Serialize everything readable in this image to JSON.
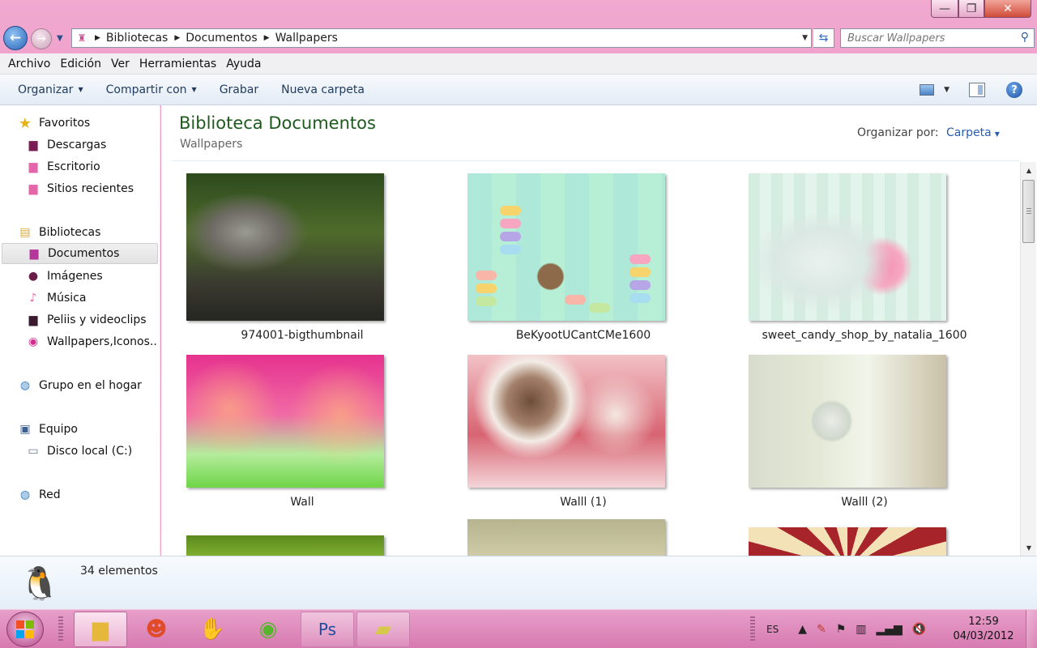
{
  "window": {
    "minimize_glyph": "—",
    "maximize_glyph": "❐",
    "close_glyph": "✕"
  },
  "nav": {
    "back_glyph": "←",
    "forward_glyph": "→",
    "breadcrumb": [
      "Bibliotecas",
      "Documentos",
      "Wallpapers"
    ],
    "search_placeholder": "Buscar Wallpapers"
  },
  "menu": [
    "Archivo",
    "Edición",
    "Ver",
    "Herramientas",
    "Ayuda"
  ],
  "commands": [
    "Organizar",
    "Compartir con",
    "Grabar",
    "Nueva carpeta"
  ],
  "sidebar": {
    "favorites": {
      "label": "Favoritos",
      "items": [
        "Descargas",
        "Escritorio",
        "Sitios recientes"
      ]
    },
    "libraries": {
      "label": "Bibliotecas",
      "items": [
        "Documentos",
        "Imágenes",
        "Música",
        "Peliis y videoclips",
        "Wallpapers,Iconos.."
      ]
    },
    "homegroup": "Grupo en el hogar",
    "computer": {
      "label": "Equipo",
      "items": [
        "Disco local (C:)"
      ]
    },
    "network": "Red"
  },
  "content": {
    "title": "Biblioteca Documentos",
    "subtitle": "Wallpapers",
    "arrange_label": "Organizar por:",
    "arrange_value": "Carpeta",
    "files": [
      {
        "name": "974001-bigthumbnail"
      },
      {
        "name": "BeKyootUCantCMe1600"
      },
      {
        "name": "sweet_candy_shop_by_natalia_1600"
      },
      {
        "name": "Wall"
      },
      {
        "name": "Walll (1)"
      },
      {
        "name": "Walll (2)"
      },
      {
        "name": ""
      },
      {
        "name": ""
      },
      {
        "name": ""
      }
    ]
  },
  "status": {
    "count": "34 elementos"
  },
  "taskbar": {
    "lang": "ES",
    "time": "12:59",
    "date": "04/03/2012"
  },
  "colors": {
    "title_green": "#1e5a1e",
    "link_blue": "#2a5db0",
    "taskbar_pink": "#d77ab1"
  }
}
